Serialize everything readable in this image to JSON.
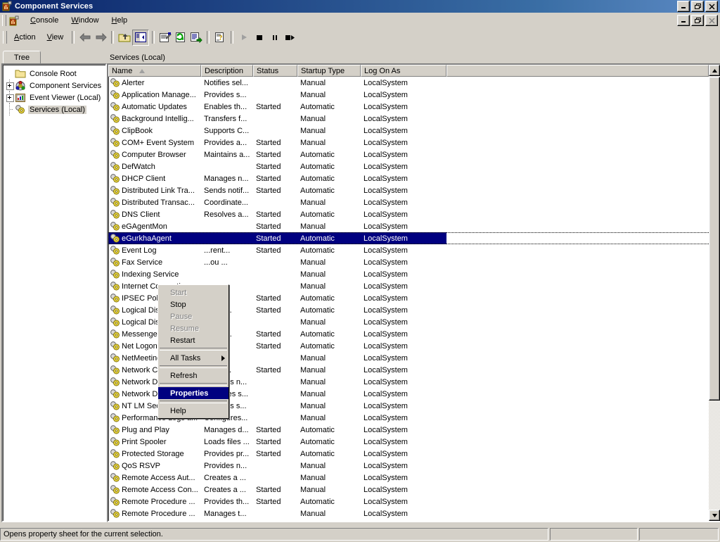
{
  "window": {
    "title": "Component Services",
    "icon": "component-services-icon",
    "controls": {
      "minimize": "_",
      "restore": "restore",
      "close": "x"
    }
  },
  "menubar": {
    "items": [
      {
        "label": "Console",
        "accel": "C"
      },
      {
        "label": "Window",
        "accel": "W"
      },
      {
        "label": "Help",
        "accel": "H"
      }
    ],
    "child_controls": {
      "minimize": "_",
      "restore": "restore",
      "close": "x"
    }
  },
  "toolbar": {
    "action_label": "Action",
    "view_label": "View",
    "buttons": [
      "back-icon",
      "forward-icon",
      "up-one-level-icon",
      "show-hide-tree-icon",
      "properties-icon",
      "refresh-icon",
      "export-list-icon",
      "help-icon",
      "start-service-icon",
      "stop-service-icon",
      "pause-service-icon",
      "restart-service-icon"
    ]
  },
  "tabs": {
    "tree_tab": "Tree",
    "pane_title": "Services (Local)"
  },
  "tree": {
    "items": [
      {
        "label": "Console Root",
        "icon": "folder-icon",
        "expander": "none",
        "selected": false,
        "indent": 0
      },
      {
        "label": "Component Services",
        "icon": "component-services-icon",
        "expander": "plus",
        "selected": false,
        "indent": 1
      },
      {
        "label": "Event Viewer (Local)",
        "icon": "event-viewer-icon",
        "expander": "plus",
        "selected": false,
        "indent": 1
      },
      {
        "label": "Services (Local)",
        "icon": "services-icon",
        "expander": "none",
        "selected": true,
        "indent": 1
      }
    ]
  },
  "list": {
    "columns": [
      {
        "label": "Name",
        "sorted": true
      },
      {
        "label": "Description",
        "sorted": false
      },
      {
        "label": "Status",
        "sorted": false
      },
      {
        "label": "Startup Type",
        "sorted": false
      },
      {
        "label": "Log On As",
        "sorted": false
      },
      {
        "label": "",
        "sorted": false
      }
    ],
    "rows": [
      {
        "name": "Alerter",
        "description": "Notifies sel...",
        "status": "",
        "startup": "Manual",
        "logon": "LocalSystem",
        "selected": false
      },
      {
        "name": "Application Manage...",
        "description": "Provides s...",
        "status": "",
        "startup": "Manual",
        "logon": "LocalSystem",
        "selected": false
      },
      {
        "name": "Automatic Updates",
        "description": "Enables th...",
        "status": "Started",
        "startup": "Automatic",
        "logon": "LocalSystem",
        "selected": false
      },
      {
        "name": "Background Intellig...",
        "description": "Transfers f...",
        "status": "",
        "startup": "Manual",
        "logon": "LocalSystem",
        "selected": false
      },
      {
        "name": "ClipBook",
        "description": "Supports C...",
        "status": "",
        "startup": "Manual",
        "logon": "LocalSystem",
        "selected": false
      },
      {
        "name": "COM+ Event System",
        "description": "Provides a...",
        "status": "Started",
        "startup": "Manual",
        "logon": "LocalSystem",
        "selected": false
      },
      {
        "name": "Computer Browser",
        "description": "Maintains a...",
        "status": "Started",
        "startup": "Automatic",
        "logon": "LocalSystem",
        "selected": false
      },
      {
        "name": "DefWatch",
        "description": "",
        "status": "Started",
        "startup": "Automatic",
        "logon": "LocalSystem",
        "selected": false
      },
      {
        "name": "DHCP Client",
        "description": "Manages n...",
        "status": "Started",
        "startup": "Automatic",
        "logon": "LocalSystem",
        "selected": false
      },
      {
        "name": "Distributed Link Tra...",
        "description": "Sends notif...",
        "status": "Started",
        "startup": "Automatic",
        "logon": "LocalSystem",
        "selected": false
      },
      {
        "name": "Distributed Transac...",
        "description": "Coordinate...",
        "status": "",
        "startup": "Manual",
        "logon": "LocalSystem",
        "selected": false
      },
      {
        "name": "DNS Client",
        "description": "Resolves a...",
        "status": "Started",
        "startup": "Automatic",
        "logon": "LocalSystem",
        "selected": false
      },
      {
        "name": "eGAgentMon",
        "description": "",
        "status": "Started",
        "startup": "Manual",
        "logon": "LocalSystem",
        "selected": false
      },
      {
        "name": "eGurkhaAgent",
        "description": "",
        "status": "Started",
        "startup": "Automatic",
        "logon": "LocalSystem",
        "selected": true
      },
      {
        "name": "Event Log",
        "description": "...rent...",
        "status": "Started",
        "startup": "Automatic",
        "logon": "LocalSystem",
        "selected": false
      },
      {
        "name": "Fax Service",
        "description": "...ou ...",
        "status": "",
        "startup": "Manual",
        "logon": "LocalSystem",
        "selected": false
      },
      {
        "name": "Indexing Service",
        "description": "",
        "status": "",
        "startup": "Manual",
        "logon": "LocalSystem",
        "selected": false
      },
      {
        "name": "Internet Connectio...",
        "description": "...s n...",
        "status": "",
        "startup": "Manual",
        "logon": "LocalSystem",
        "selected": false
      },
      {
        "name": "IPSEC Policy Agent",
        "description": "...es I...",
        "status": "Started",
        "startup": "Automatic",
        "logon": "LocalSystem",
        "selected": false
      },
      {
        "name": "Logical Disk Mana...",
        "description": "...Disk...",
        "status": "Started",
        "startup": "Automatic",
        "logon": "LocalSystem",
        "selected": false
      },
      {
        "name": "Logical Disk Mana...",
        "description": "...trat...",
        "status": "",
        "startup": "Manual",
        "logon": "LocalSystem",
        "selected": false
      },
      {
        "name": "Messenger",
        "description": "...and ...",
        "status": "Started",
        "startup": "Automatic",
        "logon": "LocalSystem",
        "selected": false
      },
      {
        "name": "Net Logon",
        "description": "...ts p...",
        "status": "Started",
        "startup": "Automatic",
        "logon": "LocalSystem",
        "selected": false
      },
      {
        "name": "NetMeeting Remot...",
        "description": "...aut...",
        "status": "",
        "startup": "Manual",
        "logon": "LocalSystem",
        "selected": false
      },
      {
        "name": "Network Connectio...",
        "description": "...es o...",
        "status": "Started",
        "startup": "Manual",
        "logon": "LocalSystem",
        "selected": false
      },
      {
        "name": "Network DDE",
        "description": "Provides n...",
        "status": "",
        "startup": "Manual",
        "logon": "LocalSystem",
        "selected": false
      },
      {
        "name": "Network DDE DSDM",
        "description": "Manages s...",
        "status": "",
        "startup": "Manual",
        "logon": "LocalSystem",
        "selected": false
      },
      {
        "name": "NT LM Security Sup...",
        "description": "Provides s...",
        "status": "",
        "startup": "Manual",
        "logon": "LocalSystem",
        "selected": false
      },
      {
        "name": "Performance Logs a...",
        "description": "Configures...",
        "status": "",
        "startup": "Manual",
        "logon": "LocalSystem",
        "selected": false
      },
      {
        "name": "Plug and Play",
        "description": "Manages d...",
        "status": "Started",
        "startup": "Automatic",
        "logon": "LocalSystem",
        "selected": false
      },
      {
        "name": "Print Spooler",
        "description": "Loads files ...",
        "status": "Started",
        "startup": "Automatic",
        "logon": "LocalSystem",
        "selected": false
      },
      {
        "name": "Protected Storage",
        "description": "Provides pr...",
        "status": "Started",
        "startup": "Automatic",
        "logon": "LocalSystem",
        "selected": false
      },
      {
        "name": "QoS RSVP",
        "description": "Provides n...",
        "status": "",
        "startup": "Manual",
        "logon": "LocalSystem",
        "selected": false
      },
      {
        "name": "Remote Access Aut...",
        "description": "Creates a ...",
        "status": "",
        "startup": "Manual",
        "logon": "LocalSystem",
        "selected": false
      },
      {
        "name": "Remote Access Con...",
        "description": "Creates a ...",
        "status": "Started",
        "startup": "Manual",
        "logon": "LocalSystem",
        "selected": false
      },
      {
        "name": "Remote Procedure ...",
        "description": "Provides th...",
        "status": "Started",
        "startup": "Automatic",
        "logon": "LocalSystem",
        "selected": false
      },
      {
        "name": "Remote Procedure ...",
        "description": "Manages t...",
        "status": "",
        "startup": "Manual",
        "logon": "LocalSystem",
        "selected": false
      }
    ]
  },
  "context_menu": {
    "items": [
      {
        "label": "Start",
        "state": "disabled",
        "type": "item"
      },
      {
        "label": "Stop",
        "state": "normal",
        "type": "item"
      },
      {
        "label": "Pause",
        "state": "disabled",
        "type": "item"
      },
      {
        "label": "Resume",
        "state": "disabled",
        "type": "item"
      },
      {
        "label": "Restart",
        "state": "normal",
        "type": "item"
      },
      {
        "label": "",
        "state": "normal",
        "type": "separator"
      },
      {
        "label": "All Tasks",
        "state": "submenu",
        "type": "item"
      },
      {
        "label": "",
        "state": "normal",
        "type": "separator"
      },
      {
        "label": "Refresh",
        "state": "normal",
        "type": "item"
      },
      {
        "label": "",
        "state": "normal",
        "type": "separator"
      },
      {
        "label": "Properties",
        "state": "highlighted",
        "type": "item"
      },
      {
        "label": "",
        "state": "normal",
        "type": "separator"
      },
      {
        "label": "Help",
        "state": "normal",
        "type": "item"
      }
    ]
  },
  "statusbar": {
    "message": "Opens property sheet for the current selection.",
    "panel2": "",
    "panel3": ""
  },
  "colors": {
    "titlebar_start": "#0a246a",
    "titlebar_end": "#5d8ac4",
    "face": "#d4d0c8",
    "selection": "#000080",
    "selection_text": "#ffffff"
  }
}
